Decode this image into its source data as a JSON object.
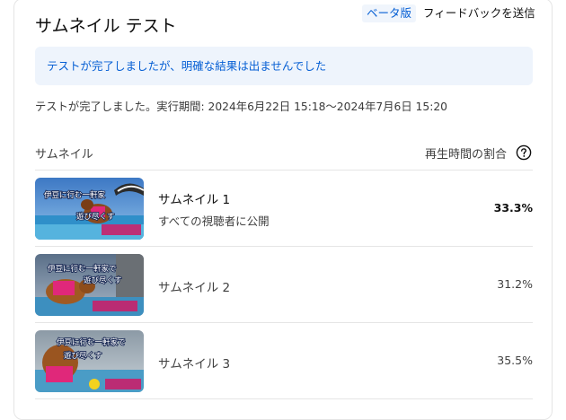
{
  "header": {
    "title": "サムネイル テスト",
    "beta_label": "ベータ版",
    "feedback_label": "フィードバックを送信"
  },
  "banner": {
    "message": "テストが完了しましたが、明確な結果は出ませんでした"
  },
  "test_period": "テストが完了しました。実行期間: 2024年6月22日 15:18～2024年7月6日 15:20",
  "table": {
    "col_thumbnail": "サムネイル",
    "col_watch_ratio": "再生時間の割合",
    "help_icon": "question-circle-icon",
    "rows": [
      {
        "name": "サムネイル 1",
        "subtitle": "すべての視聴者に公開",
        "percent": "33.3%",
        "thumb_text_line1": "伊豆に行む一軒家",
        "thumb_text_line2": "遊び尽くす"
      },
      {
        "name": "サムネイル 2",
        "subtitle": "",
        "percent": "31.2%",
        "thumb_text_line1": "伊豆に行む一軒家で",
        "thumb_text_line2": "遊び尽くす"
      },
      {
        "name": "サムネイル 3",
        "subtitle": "",
        "percent": "35.5%",
        "thumb_text_line1": "伊豆に行む一軒家で",
        "thumb_text_line2": "遊び尽くす"
      }
    ]
  },
  "colors": {
    "link_blue": "#065fd4",
    "banner_bg": "#eef4fc",
    "divider": "#e5e5e5"
  }
}
